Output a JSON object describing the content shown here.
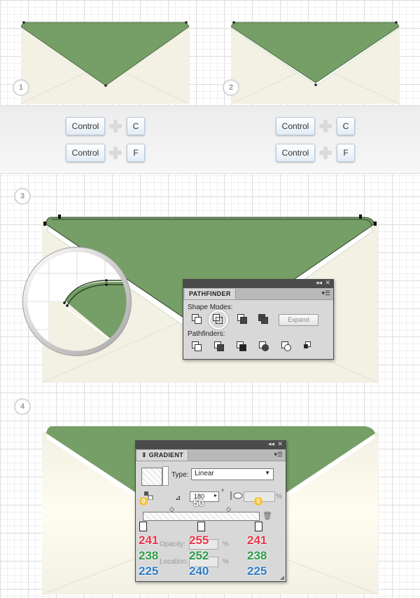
{
  "steps": {
    "one": "1",
    "two": "2",
    "three": "3",
    "four": "4"
  },
  "shortcuts": {
    "left": {
      "key1": "Control",
      "key2a": "C",
      "key2b": "F"
    },
    "right": {
      "key1": "Control",
      "key2a": "C",
      "key2b": "F"
    }
  },
  "pathfinder": {
    "title": "PATHFINDER",
    "shape_modes_label": "Shape Modes:",
    "pathfinders_label": "Pathfinders:",
    "expand_label": "Expand"
  },
  "gradient": {
    "title": "GRADIENT",
    "type_label": "Type:",
    "type_value": "Linear",
    "angle_value": "180",
    "angle_unit": "°",
    "percent_unit": "%",
    "opacity_label": "Opacity:",
    "location_label": "Location:",
    "badge_left": "0",
    "badge_center": "50",
    "badge_right": "0",
    "stops": [
      {
        "r": "241",
        "g": "238",
        "b": "225"
      },
      {
        "r": "255",
        "g": "252",
        "b": "240"
      },
      {
        "r": "241",
        "g": "238",
        "b": "225"
      }
    ]
  },
  "colors": {
    "flap_green": "#769e67",
    "envelope_cream": "#f3f0e4",
    "red": "#e8354a",
    "green": "#2e9b46",
    "blue": "#2e7dc4"
  }
}
